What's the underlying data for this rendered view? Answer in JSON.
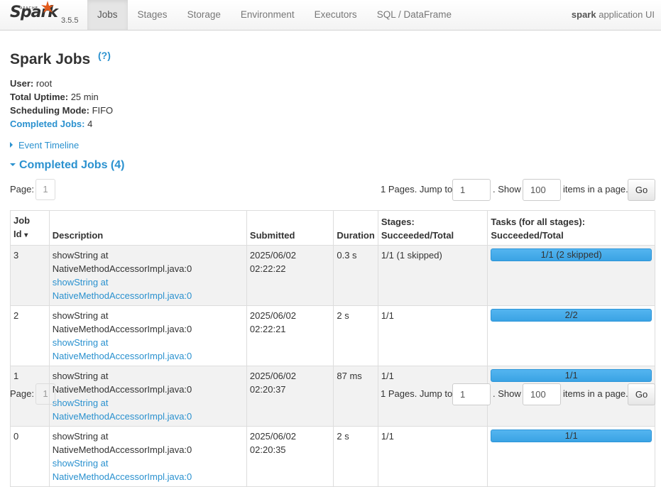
{
  "navbar": {
    "brand_apache": "APACHE",
    "brand_name": "Spark",
    "version": "3.5.5",
    "tabs": [
      {
        "label": "Jobs",
        "active": true
      },
      {
        "label": "Stages",
        "active": false
      },
      {
        "label": "Storage",
        "active": false
      },
      {
        "label": "Environment",
        "active": false
      },
      {
        "label": "Executors",
        "active": false
      },
      {
        "label": "SQL / DataFrame",
        "active": false
      }
    ],
    "app_name": "spark",
    "app_suffix": " application UI"
  },
  "page": {
    "title": "Spark Jobs",
    "help": "(?)"
  },
  "summary": {
    "user_label": "User:",
    "user_value": " root",
    "uptime_label": "Total Uptime:",
    "uptime_value": " 25 min",
    "sched_label": "Scheduling Mode:",
    "sched_value": " FIFO",
    "completed_label": "Completed Jobs:",
    "completed_value": " 4"
  },
  "event_timeline": "Event Timeline",
  "completed_section": "Completed Jobs (4)",
  "pagination": {
    "page_label": "Page:",
    "current_page": "1",
    "jump_text": "1 Pages. Jump to",
    "jump_value": "1",
    "show_text": ". Show",
    "show_value": "100",
    "items_text": "items in a page.",
    "go_label": "Go"
  },
  "table": {
    "headers": {
      "job_id_line1": "Job",
      "job_id_line2": "Id",
      "sort_indicator": "▾",
      "description": "Description",
      "submitted": "Submitted",
      "duration": "Duration",
      "stages_line1": "Stages:",
      "stages_line2": "Succeeded/Total",
      "tasks_line1": "Tasks (for all stages):",
      "tasks_line2": "Succeeded/Total"
    },
    "rows": [
      {
        "id": "3",
        "desc": "showString at NativeMethodAccessorImpl.java:0",
        "desc_link": "showString at NativeMethodAccessorImpl.java:0",
        "submitted_date": "2025/06/02",
        "submitted_time": "02:22:22",
        "duration": "0.3 s",
        "stages": "1/1 (1 skipped)",
        "tasks": "1/1 (2 skipped)",
        "progress": 1.0
      },
      {
        "id": "2",
        "desc": "showString at NativeMethodAccessorImpl.java:0",
        "desc_link": "showString at NativeMethodAccessorImpl.java:0",
        "submitted_date": "2025/06/02",
        "submitted_time": "02:22:21",
        "duration": "2 s",
        "stages": "1/1",
        "tasks": "2/2",
        "progress": 1.0
      },
      {
        "id": "1",
        "desc": "showString at NativeMethodAccessorImpl.java:0",
        "desc_link": "showString at NativeMethodAccessorImpl.java:0",
        "submitted_date": "2025/06/02",
        "submitted_time": "02:20:37",
        "duration": "87 ms",
        "stages": "1/1",
        "tasks": "1/1",
        "progress": 1.0
      },
      {
        "id": "0",
        "desc": "showString at NativeMethodAccessorImpl.java:0",
        "desc_link": "showString at NativeMethodAccessorImpl.java:0",
        "submitted_date": "2025/06/02",
        "submitted_time": "02:20:35",
        "duration": "2 s",
        "stages": "1/1",
        "tasks": "1/1",
        "progress": 1.0
      }
    ]
  },
  "colors": {
    "link": "#2a91cf",
    "progress_bar": "#3aa3e4",
    "logo_star": "#e25a1c"
  }
}
